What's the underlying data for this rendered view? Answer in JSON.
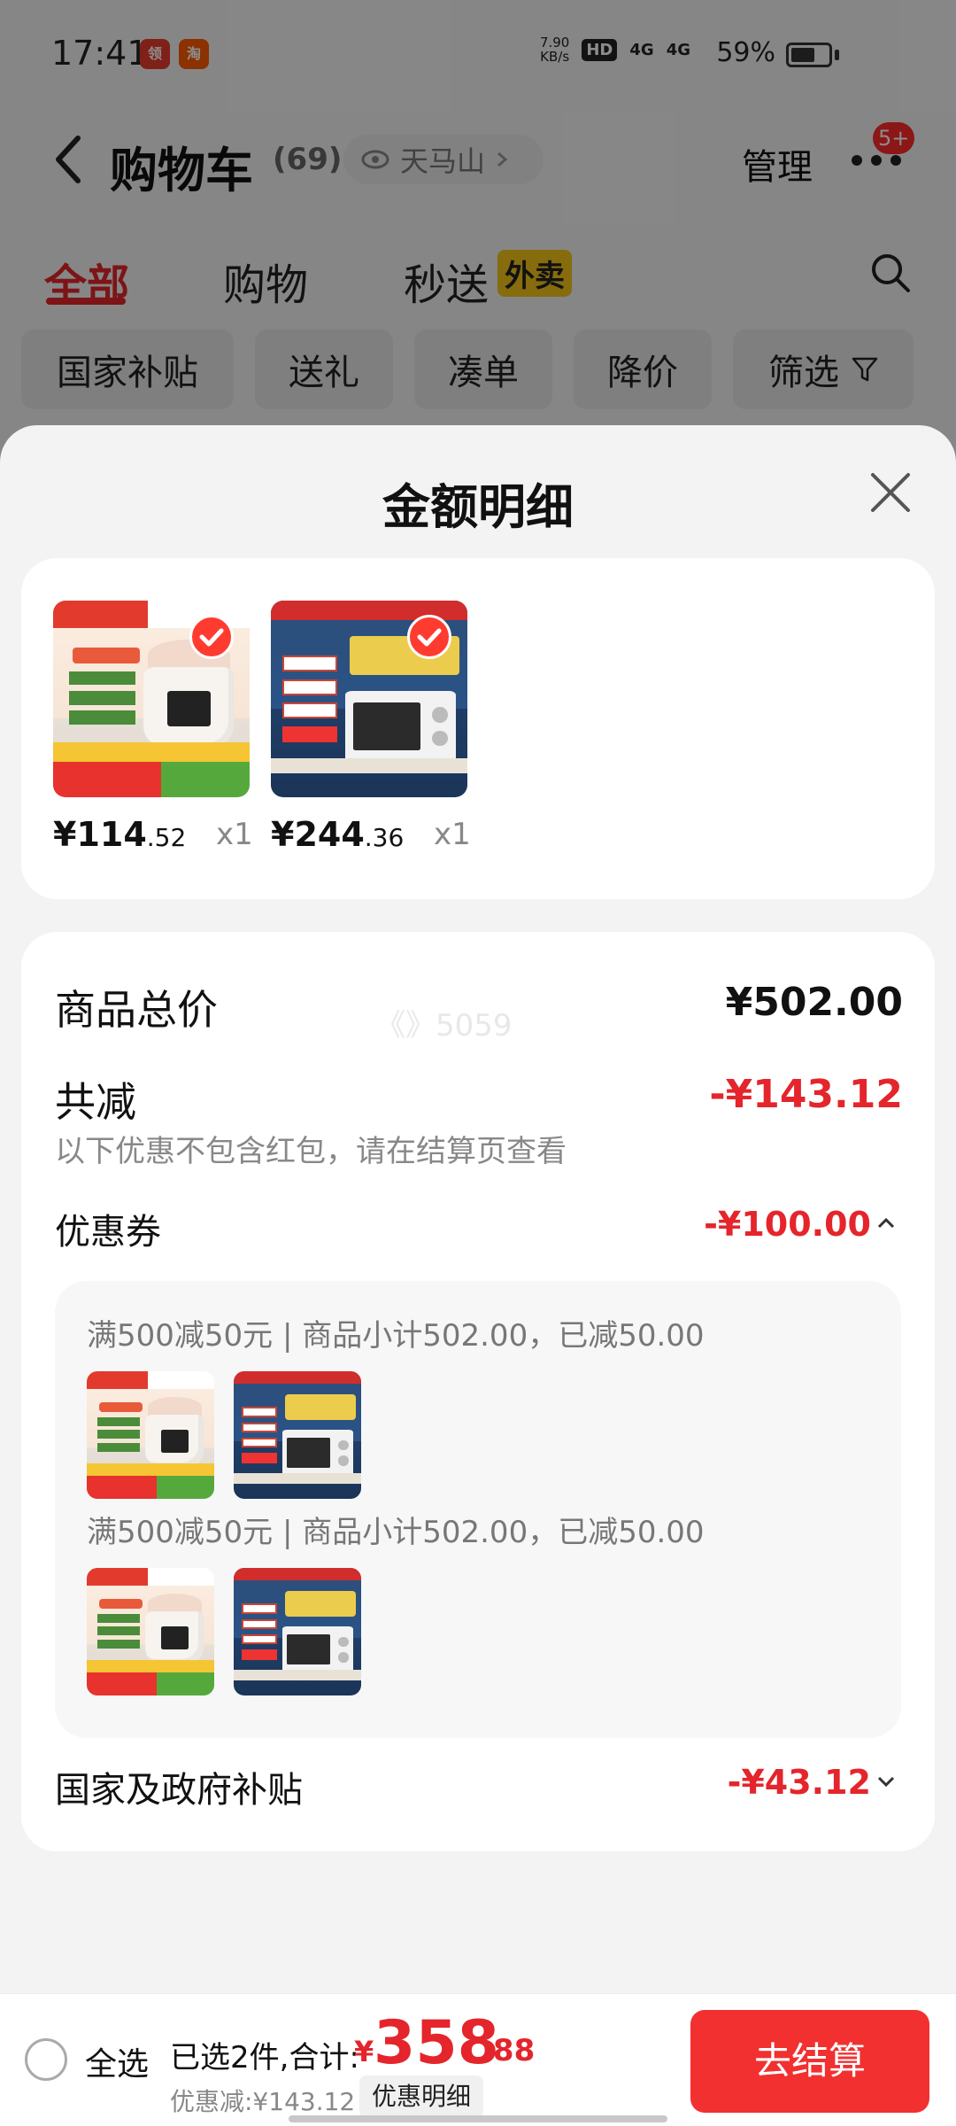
{
  "status_bar": {
    "time": "17:41",
    "net_speed_value": "7.90",
    "net_speed_unit": "KB/s",
    "hd_badge": "HD",
    "signal_1": "4G",
    "signal_2": "4G",
    "battery_percent": "59%",
    "app_icon_1_text": "领",
    "app_icon_2_text": "淘"
  },
  "nav": {
    "title": "购物车",
    "count": "(69)",
    "location": "天马山",
    "manage_label": "管理",
    "more_badge": "5+"
  },
  "tabs": [
    {
      "label": "全部",
      "active": true
    },
    {
      "label": "购物",
      "active": false
    },
    {
      "label": "秒送",
      "active": false
    }
  ],
  "tab_tag": "外卖",
  "filter_chips": [
    "国家补贴",
    "送礼",
    "凑单",
    "降价",
    "筛选"
  ],
  "sheet": {
    "title": "金额明细",
    "watermark": "《》5059",
    "products": [
      {
        "price_int": "¥114",
        "price_dec": ".52",
        "qty": "x1",
        "image": "rice-cooker"
      },
      {
        "price_int": "¥244",
        "price_dec": ".36",
        "qty": "x1",
        "image": "microwave"
      }
    ],
    "total_label": "商品总价",
    "total_value": "¥502.00",
    "discount_label": "共减",
    "discount_value": "-¥143.12",
    "discount_note": "以下优惠不包含红包，请在结算页查看",
    "coupon_label": "优惠券",
    "coupon_value": "-¥100.00",
    "coupon_groups": [
      {
        "text": "满500减50元 | 商品小计502.00，已减50.00"
      },
      {
        "text": "满500减50元 | 商品小计502.00，已减50.00"
      }
    ],
    "subsidy_label": "国家及政府补贴",
    "subsidy_value": "-¥43.12"
  },
  "bottom_bar": {
    "select_all": "全选",
    "summary_label": "已选2件,合计:",
    "total_yen": "¥",
    "total_int": "358",
    "total_dec": ".88",
    "discount_text": "优惠减:¥143.12",
    "detail_button": "优惠明细",
    "checkout_button": "去结算"
  },
  "colors": {
    "accent_red": "#e4252b",
    "checkout_red": "#f23030",
    "tab_tag_yellow": "#f5c518"
  }
}
